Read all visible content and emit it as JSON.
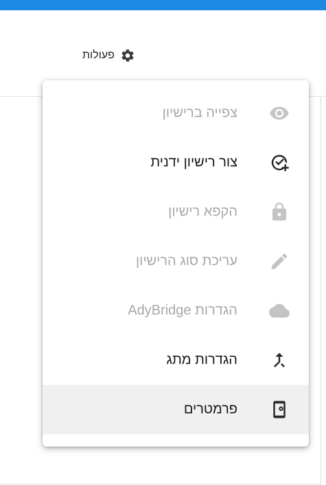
{
  "header": {
    "actions_label": "פעולות",
    "actions_icon": "gear-icon"
  },
  "menu": {
    "items": [
      {
        "label": "צפייה ברישיון",
        "icon": "eye-icon",
        "enabled": false
      },
      {
        "label": "צור רישיון ידנית",
        "icon": "check-circle-add-icon",
        "enabled": true
      },
      {
        "label": "הקפא רישיון",
        "icon": "lock-icon",
        "enabled": false
      },
      {
        "label": "עריכת סוג הרישיון",
        "icon": "pencil-icon",
        "enabled": false
      },
      {
        "label": "הגדרות AdyBridge",
        "icon": "cloud-icon",
        "enabled": false
      },
      {
        "label": "הגדרות מתג",
        "icon": "merge-icon",
        "enabled": true
      },
      {
        "label": "פרמטרים",
        "icon": "device-settings-icon",
        "enabled": true,
        "highlighted": true
      }
    ]
  },
  "colors": {
    "accent_bar": "#1e88e5",
    "disabled_text": "#a7a7a7",
    "enabled_text": "#141414",
    "highlight_bg": "#f0f0f0"
  }
}
